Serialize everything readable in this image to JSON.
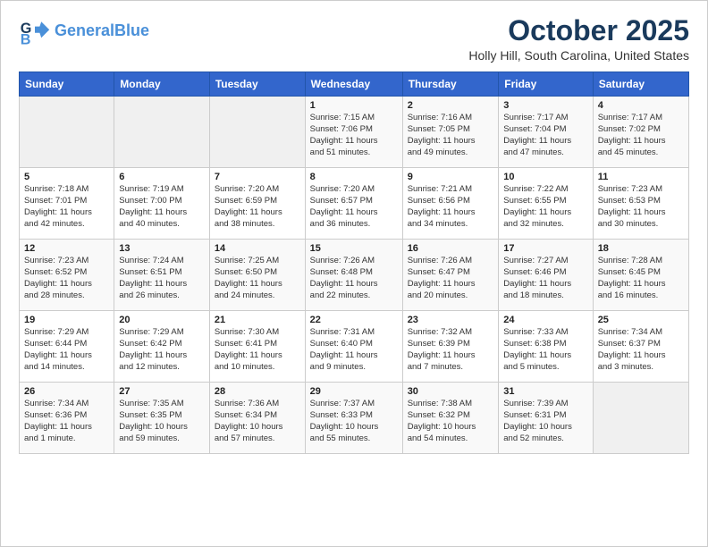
{
  "header": {
    "logo_line1": "General",
    "logo_line2": "Blue",
    "title": "October 2025",
    "subtitle": "Holly Hill, South Carolina, United States"
  },
  "weekdays": [
    "Sunday",
    "Monday",
    "Tuesday",
    "Wednesday",
    "Thursday",
    "Friday",
    "Saturday"
  ],
  "weeks": [
    [
      {
        "day": "",
        "info": ""
      },
      {
        "day": "",
        "info": ""
      },
      {
        "day": "",
        "info": ""
      },
      {
        "day": "1",
        "info": "Sunrise: 7:15 AM\nSunset: 7:06 PM\nDaylight: 11 hours\nand 51 minutes."
      },
      {
        "day": "2",
        "info": "Sunrise: 7:16 AM\nSunset: 7:05 PM\nDaylight: 11 hours\nand 49 minutes."
      },
      {
        "day": "3",
        "info": "Sunrise: 7:17 AM\nSunset: 7:04 PM\nDaylight: 11 hours\nand 47 minutes."
      },
      {
        "day": "4",
        "info": "Sunrise: 7:17 AM\nSunset: 7:02 PM\nDaylight: 11 hours\nand 45 minutes."
      }
    ],
    [
      {
        "day": "5",
        "info": "Sunrise: 7:18 AM\nSunset: 7:01 PM\nDaylight: 11 hours\nand 42 minutes."
      },
      {
        "day": "6",
        "info": "Sunrise: 7:19 AM\nSunset: 7:00 PM\nDaylight: 11 hours\nand 40 minutes."
      },
      {
        "day": "7",
        "info": "Sunrise: 7:20 AM\nSunset: 6:59 PM\nDaylight: 11 hours\nand 38 minutes."
      },
      {
        "day": "8",
        "info": "Sunrise: 7:20 AM\nSunset: 6:57 PM\nDaylight: 11 hours\nand 36 minutes."
      },
      {
        "day": "9",
        "info": "Sunrise: 7:21 AM\nSunset: 6:56 PM\nDaylight: 11 hours\nand 34 minutes."
      },
      {
        "day": "10",
        "info": "Sunrise: 7:22 AM\nSunset: 6:55 PM\nDaylight: 11 hours\nand 32 minutes."
      },
      {
        "day": "11",
        "info": "Sunrise: 7:23 AM\nSunset: 6:53 PM\nDaylight: 11 hours\nand 30 minutes."
      }
    ],
    [
      {
        "day": "12",
        "info": "Sunrise: 7:23 AM\nSunset: 6:52 PM\nDaylight: 11 hours\nand 28 minutes."
      },
      {
        "day": "13",
        "info": "Sunrise: 7:24 AM\nSunset: 6:51 PM\nDaylight: 11 hours\nand 26 minutes."
      },
      {
        "day": "14",
        "info": "Sunrise: 7:25 AM\nSunset: 6:50 PM\nDaylight: 11 hours\nand 24 minutes."
      },
      {
        "day": "15",
        "info": "Sunrise: 7:26 AM\nSunset: 6:48 PM\nDaylight: 11 hours\nand 22 minutes."
      },
      {
        "day": "16",
        "info": "Sunrise: 7:26 AM\nSunset: 6:47 PM\nDaylight: 11 hours\nand 20 minutes."
      },
      {
        "day": "17",
        "info": "Sunrise: 7:27 AM\nSunset: 6:46 PM\nDaylight: 11 hours\nand 18 minutes."
      },
      {
        "day": "18",
        "info": "Sunrise: 7:28 AM\nSunset: 6:45 PM\nDaylight: 11 hours\nand 16 minutes."
      }
    ],
    [
      {
        "day": "19",
        "info": "Sunrise: 7:29 AM\nSunset: 6:44 PM\nDaylight: 11 hours\nand 14 minutes."
      },
      {
        "day": "20",
        "info": "Sunrise: 7:29 AM\nSunset: 6:42 PM\nDaylight: 11 hours\nand 12 minutes."
      },
      {
        "day": "21",
        "info": "Sunrise: 7:30 AM\nSunset: 6:41 PM\nDaylight: 11 hours\nand 10 minutes."
      },
      {
        "day": "22",
        "info": "Sunrise: 7:31 AM\nSunset: 6:40 PM\nDaylight: 11 hours\nand 9 minutes."
      },
      {
        "day": "23",
        "info": "Sunrise: 7:32 AM\nSunset: 6:39 PM\nDaylight: 11 hours\nand 7 minutes."
      },
      {
        "day": "24",
        "info": "Sunrise: 7:33 AM\nSunset: 6:38 PM\nDaylight: 11 hours\nand 5 minutes."
      },
      {
        "day": "25",
        "info": "Sunrise: 7:34 AM\nSunset: 6:37 PM\nDaylight: 11 hours\nand 3 minutes."
      }
    ],
    [
      {
        "day": "26",
        "info": "Sunrise: 7:34 AM\nSunset: 6:36 PM\nDaylight: 11 hours\nand 1 minute."
      },
      {
        "day": "27",
        "info": "Sunrise: 7:35 AM\nSunset: 6:35 PM\nDaylight: 10 hours\nand 59 minutes."
      },
      {
        "day": "28",
        "info": "Sunrise: 7:36 AM\nSunset: 6:34 PM\nDaylight: 10 hours\nand 57 minutes."
      },
      {
        "day": "29",
        "info": "Sunrise: 7:37 AM\nSunset: 6:33 PM\nDaylight: 10 hours\nand 55 minutes."
      },
      {
        "day": "30",
        "info": "Sunrise: 7:38 AM\nSunset: 6:32 PM\nDaylight: 10 hours\nand 54 minutes."
      },
      {
        "day": "31",
        "info": "Sunrise: 7:39 AM\nSunset: 6:31 PM\nDaylight: 10 hours\nand 52 minutes."
      },
      {
        "day": "",
        "info": ""
      }
    ]
  ]
}
